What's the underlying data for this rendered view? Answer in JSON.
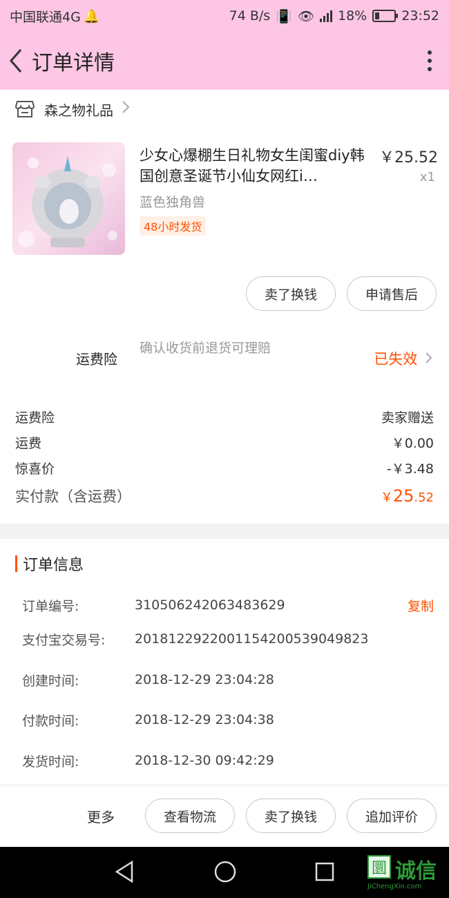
{
  "status_bar": {
    "carrier": "中国联通4G",
    "speed": "74 B/s",
    "battery": "18%",
    "time": "23:52"
  },
  "nav": {
    "title": "订单详情"
  },
  "store": {
    "name": "森之物礼品"
  },
  "product": {
    "title": "少女心爆棚生日礼物女生闺蜜diy韩国创意圣诞节小仙女网红i…",
    "price": "￥25.52",
    "qty": "x1",
    "variant": "蓝色独角兽",
    "tag": "48小时发货"
  },
  "item_actions": {
    "sell": "卖了换钱",
    "after_sale": "申请售后"
  },
  "insurance": {
    "label": "运费险",
    "desc": "确认收货前退货可理赔",
    "status": "已失效"
  },
  "fees": [
    {
      "k": "运费险",
      "v": "卖家赠送"
    },
    {
      "k": "运费",
      "v": "￥0.00"
    },
    {
      "k": "惊喜价",
      "v": "-￥3.48"
    }
  ],
  "total": {
    "label": "实付款（含运费）",
    "currency": "￥",
    "int": "25",
    "dec": ".52"
  },
  "order_info": {
    "title": "订单信息",
    "copy_label": "复制",
    "rows": [
      {
        "k": "订单编号:",
        "v": "310506242063483629"
      },
      {
        "k": "支付宝交易号:",
        "v": "2018122922001154200539049823"
      },
      {
        "k": "创建时间:",
        "v": "2018-12-29 23:04:28"
      },
      {
        "k": "付款时间:",
        "v": "2018-12-29 23:04:38"
      },
      {
        "k": "发货时间:",
        "v": "2018-12-30 09:42:29"
      }
    ]
  },
  "bottom": {
    "more": "更多",
    "logistics": "查看物流",
    "sell": "卖了换钱",
    "review": "追加评价"
  },
  "watermark": {
    "text": "诚信",
    "sub": "JiChengXin.com"
  },
  "colors": {
    "header_bg": "#fcc6e4",
    "accent": "#ff5000"
  }
}
